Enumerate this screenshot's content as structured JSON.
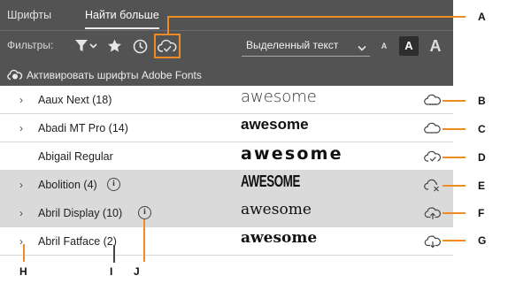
{
  "tabs": [
    {
      "label": "Шрифты",
      "active": false
    },
    {
      "label": "Найти больше",
      "active": true
    }
  ],
  "filters": {
    "label": "Фильтры:",
    "icons": [
      "filter-funnel-icon",
      "star-icon",
      "clock-icon",
      "cloud-check-icon"
    ]
  },
  "preview": {
    "selected": "Выделенный текст",
    "size_small": "A",
    "size_medium": "A",
    "size_large": "A"
  },
  "activate_label": "Активировать шрифты Adobe Fonts",
  "sample_text": "awesome",
  "fonts": [
    {
      "name": "Aaux Next (18)",
      "expandable": true,
      "info": false,
      "status_icon": "cloud-syncing-icon",
      "highlighted": false
    },
    {
      "name": "Abadi MT Pro (14)",
      "expandable": true,
      "info": false,
      "status_icon": "cloud-icon",
      "highlighted": false
    },
    {
      "name": "Abigail Regular",
      "expandable": false,
      "info": false,
      "status_icon": "cloud-check-icon",
      "highlighted": false
    },
    {
      "name": "Abolition (4)",
      "expandable": true,
      "info": true,
      "status_icon": "cloud-x-icon",
      "highlighted": true
    },
    {
      "name": "Abril Display (10)",
      "expandable": true,
      "info": true,
      "status_icon": "cloud-upload-icon",
      "highlighted": true
    },
    {
      "name": "Abril Fatface (2)",
      "expandable": true,
      "info": false,
      "status_icon": "cloud-download-icon",
      "highlighted": false
    }
  ],
  "callouts": {
    "A": "A",
    "B": "B",
    "C": "C",
    "D": "D",
    "E": "E",
    "F": "F",
    "G": "G",
    "H": "H",
    "I": "I",
    "J": "J"
  },
  "colors": {
    "panel_dark": "#535353",
    "row_highlight": "#dadada",
    "callout_orange": "#f08a24"
  }
}
